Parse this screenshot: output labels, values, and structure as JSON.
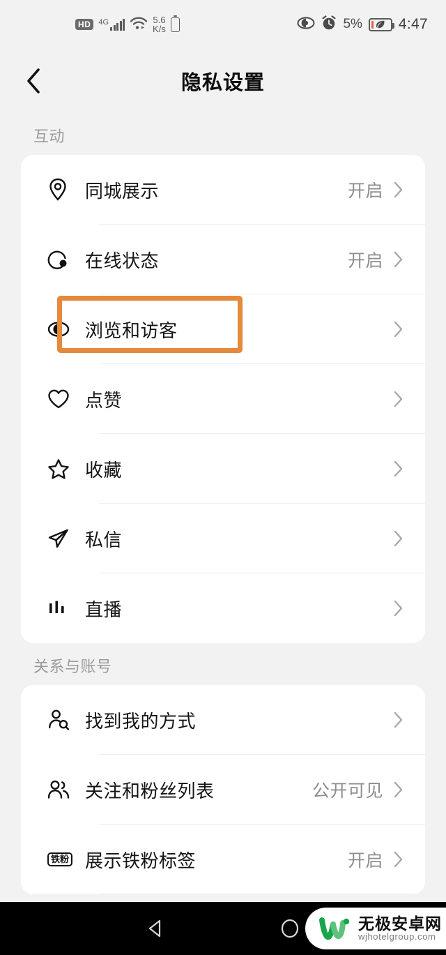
{
  "statusbar": {
    "hd_label": "HD",
    "network_gen": "4G",
    "net_speed_value": "5.6",
    "net_speed_unit": "K/s",
    "battery_percent": "5%",
    "clock": "4:47",
    "icons": [
      "hd-icon",
      "signal-icon",
      "wifi-icon",
      "network-speed",
      "battery-small-icon",
      "eye-care-icon",
      "alarm-icon",
      "battery-saver-icon"
    ]
  },
  "header": {
    "title": "隐私设置",
    "back_icon": "chevron-left-icon"
  },
  "sections": [
    {
      "label": "互动",
      "rows": [
        {
          "icon": "location-pin-icon",
          "label": "同城展示",
          "value": "开启"
        },
        {
          "icon": "online-status-icon",
          "label": "在线状态",
          "value": "开启"
        },
        {
          "icon": "eye-icon",
          "label": "浏览和访客",
          "value": "",
          "highlighted": true
        },
        {
          "icon": "heart-icon",
          "label": "点赞",
          "value": ""
        },
        {
          "icon": "star-icon",
          "label": "收藏",
          "value": ""
        },
        {
          "icon": "paper-plane-icon",
          "label": "私信",
          "value": ""
        },
        {
          "icon": "live-bars-icon",
          "label": "直播",
          "value": ""
        }
      ]
    },
    {
      "label": "关系与账号",
      "rows": [
        {
          "icon": "person-search-icon",
          "label": "找到我的方式",
          "value": ""
        },
        {
          "icon": "people-icon",
          "label": "关注和粉丝列表",
          "value": "公开可见"
        },
        {
          "icon": "fan-badge-icon",
          "label": "展示铁粉标签",
          "value": "开启",
          "badge_text": "铁粉"
        }
      ]
    }
  ],
  "navbar": {
    "back_icon": "triangle-back-icon",
    "home_icon": "circle-home-icon",
    "watermark_cn": "无极安卓网",
    "watermark_url": "wjhotelgroup.com"
  },
  "colors": {
    "highlight": "#e5893c",
    "page_bg": "#f2f2f2",
    "card_bg": "#ffffff",
    "value_text": "#8d8d8d",
    "section_label": "#9b9b9b",
    "navbar_bg": "#000000",
    "logo_green_dark": "#1aa44c",
    "logo_green_light": "#5cc47a"
  }
}
